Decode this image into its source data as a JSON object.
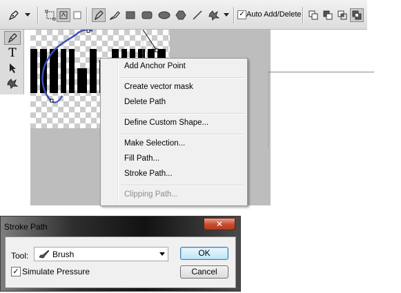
{
  "options_bar": {
    "auto_add_delete_label": "Auto Add/Delete",
    "auto_add_delete_checked": true
  },
  "context_menu": {
    "items": [
      {
        "label": "Add Anchor Point",
        "enabled": true
      },
      {
        "label": "Create vector mask",
        "enabled": true
      },
      {
        "label": "Delete Path",
        "enabled": true
      },
      {
        "label": "Define Custom Shape...",
        "enabled": true
      },
      {
        "label": "Make Selection...",
        "enabled": true
      },
      {
        "label": "Fill Path...",
        "enabled": true
      },
      {
        "label": "Stroke Path...",
        "enabled": true
      },
      {
        "label": "Clipping Path...",
        "enabled": false
      }
    ]
  },
  "dialog": {
    "title": "Stroke Path",
    "close_symbol": "✕",
    "tool_label": "Tool:",
    "tool_value": "Brush",
    "simulate_pressure_label": "Simulate Pressure",
    "simulate_pressure_checked": true,
    "ok_label": "OK",
    "cancel_label": "Cancel"
  },
  "icons": {
    "pen": "pen-icon",
    "type": "type-icon",
    "path_selection": "path-selection-arrow-icon",
    "custom_shape": "custom-shape-icon"
  },
  "colors": {
    "path_stroke": "#3b4fbd",
    "close_button": "#c74a2d",
    "ok_highlight": "#bfe6f9"
  }
}
